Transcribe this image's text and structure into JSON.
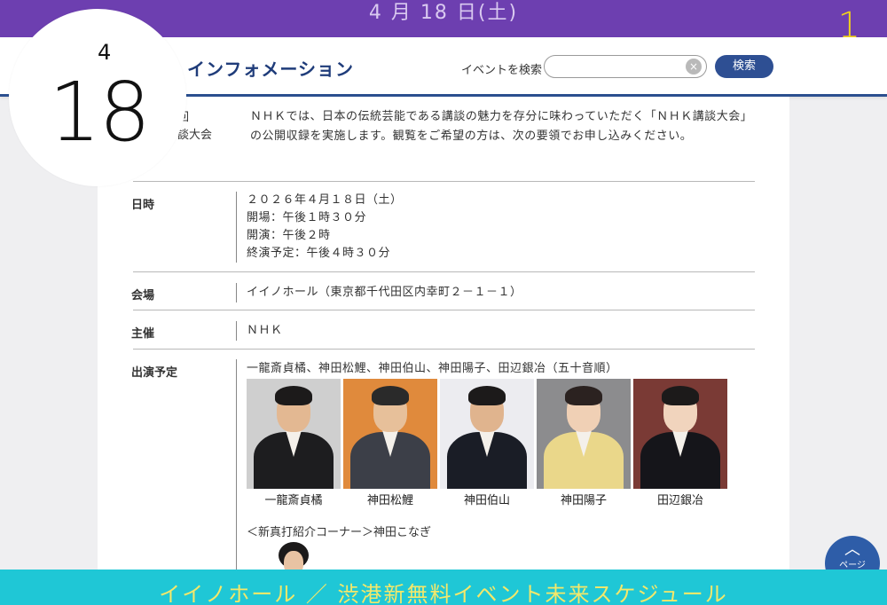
{
  "top_bar": {
    "date_text": "4 月 18 日(土)",
    "marker": "1"
  },
  "header": {
    "site_title": "・インフォメーション",
    "search_label": "イベントを検索",
    "search_placeholder": "",
    "search_clear": "×",
    "search_button": "検索"
  },
  "date_badge": {
    "month": "4",
    "day": "18"
  },
  "intro": {
    "title_line1": "回",
    "title_line2": "談大会",
    "text": "ＮＨＫでは、日本の伝統芸能である講談の魅力を存分に味わっていただく「ＮＨＫ講談大会」の公開収録を実施します。観覧をご希望の方は、次の要領でお申し込みください。"
  },
  "details": {
    "datetime_label": "日時",
    "datetime_lines": [
      "２０２６年４月１８日（土）",
      "開場：午後１時３０分",
      "開演：午後２時",
      "終演予定：午後４時３０分"
    ],
    "venue_label": "会場",
    "venue_value": "イイノホール（東京都千代田区内幸町２－１－１）",
    "host_label": "主催",
    "host_value": "ＮＨＫ",
    "cast_label": "出演予定",
    "cast_value": "一龍斎貞橘、神田松鯉、神田伯山、神田陽子、田辺銀冶（五十音順）",
    "performers": [
      "一龍斎貞橘",
      "神田松鯉",
      "神田伯山",
      "神田陽子",
      "田辺銀冶"
    ],
    "newcomer": "＜新真打紹介コーナー＞神田こなぎ"
  },
  "page_top": {
    "arrow": "︿",
    "label": "ページ"
  },
  "bottom_banner": "イイノホール ／ 渋港新無料イベント未来スケジュール",
  "colors": {
    "top_bar": "#6d3fb0",
    "banner": "#1fc7d6",
    "banner_text": "#f4e86a",
    "accent_blue": "#2e4f93"
  }
}
